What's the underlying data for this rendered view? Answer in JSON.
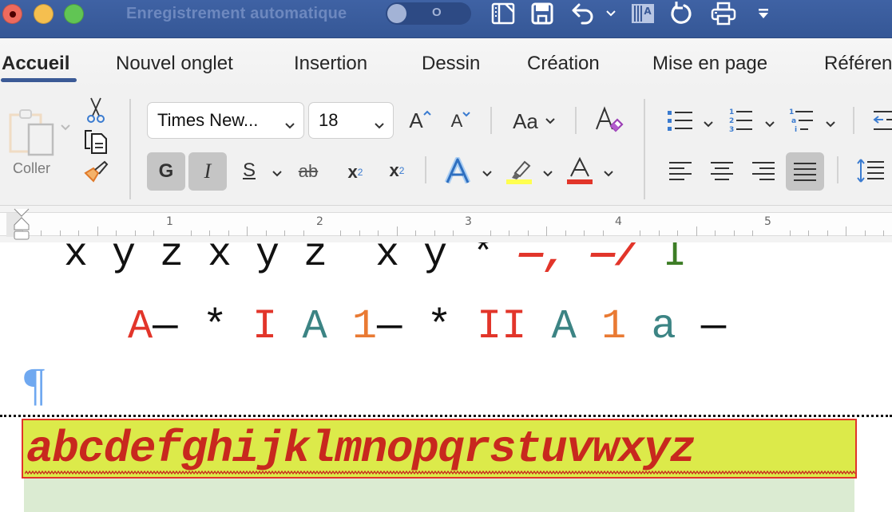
{
  "titlebar": {
    "autosave_label": "Enregistrement automatique",
    "autosave_state": "O",
    "quick_access": [
      "sidebar-icon",
      "save-icon",
      "undo-icon",
      "undo-dropdown",
      "text-direction-icon",
      "redo-icon",
      "print-icon",
      "customize-toolbar-icon"
    ]
  },
  "tabs": [
    {
      "label": "Accueil",
      "active": true
    },
    {
      "label": "Nouvel onglet"
    },
    {
      "label": "Insertion"
    },
    {
      "label": "Dessin"
    },
    {
      "label": "Création"
    },
    {
      "label": "Mise en page"
    },
    {
      "label": "Référen"
    }
  ],
  "ribbon": {
    "clipboard": {
      "paste_label": "Coller"
    },
    "font": {
      "name": "Times New...",
      "size": "18",
      "bold_label": "G",
      "italic_label": "I",
      "underline_label": "S",
      "strike_label": "ab",
      "subscript_label": "x",
      "subscript_sup": "2",
      "superscript_label": "x",
      "superscript_sup": "2",
      "change_case_label": "Aa",
      "grow_label": "A",
      "shrink_label": "A",
      "highlight_color": "#ffff4f",
      "font_color": "#e2352a"
    },
    "paragraph": {
      "justify_active": true
    }
  },
  "ruler": {
    "numbers": [
      "1",
      "2",
      "3",
      "4",
      "5"
    ]
  },
  "document": {
    "line1": [
      {
        "text": "x y z x y z  x y ",
        "cls": ""
      },
      {
        "text": "* ",
        "cls": ""
      },
      {
        "text": "—, —/ ",
        "cls": "c-bold-red"
      },
      {
        "text": "I",
        "cls": "c-green"
      }
    ],
    "line2": [
      {
        "text": "A",
        "cls": "c-red"
      },
      {
        "text": "— * ",
        "cls": ""
      },
      {
        "text": "I",
        "cls": "c-red"
      },
      {
        "text": " ",
        "cls": ""
      },
      {
        "text": "A",
        "cls": "c-teal"
      },
      {
        "text": " ",
        "cls": ""
      },
      {
        "text": "1",
        "cls": "c-orange"
      },
      {
        "text": "— * ",
        "cls": ""
      },
      {
        "text": "II",
        "cls": "c-red"
      },
      {
        "text": " ",
        "cls": ""
      },
      {
        "text": "A",
        "cls": "c-teal"
      },
      {
        "text": " ",
        "cls": ""
      },
      {
        "text": "1",
        "cls": "c-orange"
      },
      {
        "text": " ",
        "cls": ""
      },
      {
        "text": "a",
        "cls": "c-teal"
      },
      {
        "text": " —",
        "cls": ""
      }
    ],
    "pilcrow": "¶",
    "alphabet": "abcdefghijklmnopqrstuvwxyz",
    "colors": {
      "highlight": "#dcea4a",
      "text": "#c8281e",
      "frame": "#e2352a",
      "band": "#dbebd2"
    }
  }
}
